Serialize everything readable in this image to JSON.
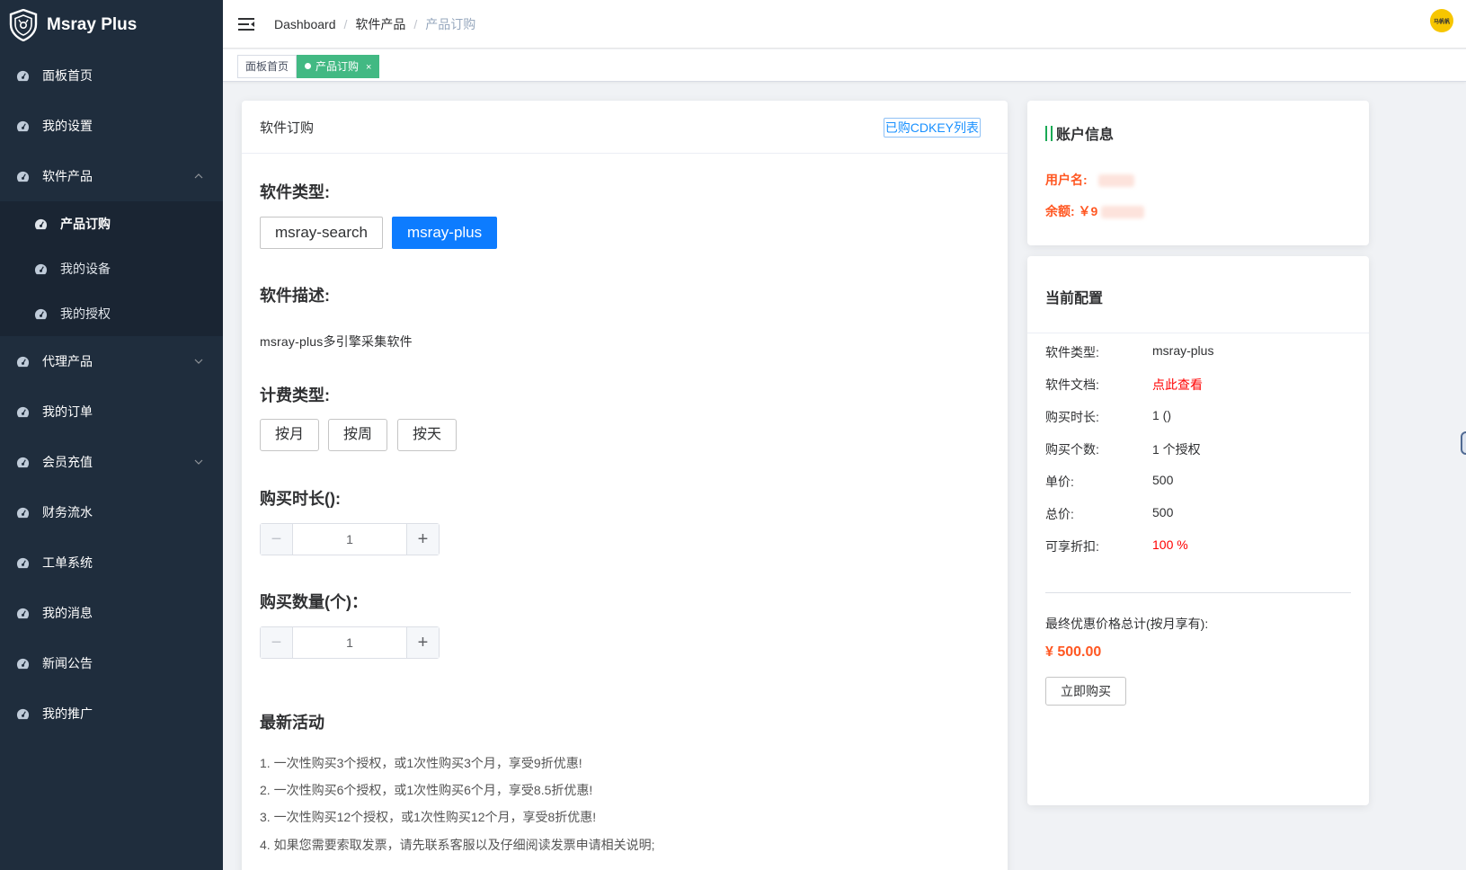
{
  "app": {
    "title": "Msray Plus"
  },
  "sidebar": {
    "items": [
      {
        "label": "面板首页"
      },
      {
        "label": "我的设置"
      },
      {
        "label": "软件产品"
      },
      {
        "label": "代理产品"
      },
      {
        "label": "我的订单"
      },
      {
        "label": "会员充值"
      },
      {
        "label": "财务流水"
      },
      {
        "label": "工单系统"
      },
      {
        "label": "我的消息"
      },
      {
        "label": "新闻公告"
      },
      {
        "label": "我的推广"
      }
    ],
    "submenu": [
      {
        "label": "产品订购"
      },
      {
        "label": "我的设备"
      },
      {
        "label": "我的授权"
      }
    ]
  },
  "header": {
    "breadcrumb": [
      "Dashboard",
      "软件产品",
      "产品订购"
    ],
    "breadcrumb_sep": "/",
    "avatar_text": "马帆帆"
  },
  "tags": [
    {
      "label": "面板首页"
    },
    {
      "label": "产品订购",
      "close": "×"
    }
  ],
  "main": {
    "card_title": "软件订购",
    "cdkey_button": "已购CDKEY列表",
    "software_type_title": "软件类型:",
    "software_types": [
      "msray-search",
      "msray-plus"
    ],
    "selected_type": "msray-plus",
    "description_title": "软件描述:",
    "description": "msray-plus多引擎采集软件",
    "billing_title": "计费类型:",
    "billing_types": [
      "按月",
      "按周",
      "按天"
    ],
    "duration_title": "购买时长():",
    "duration_value": "1",
    "quantity_title": "购买数量(个)：",
    "quantity_value": "1",
    "activity_title": "最新活动",
    "activities": [
      "1. 一次性购买3个授权，或1次性购买3个月，享受9折优惠!",
      "2. 一次性购买6个授权，或1次性购买6个月，享受8.5折优惠!",
      "3. 一次性购买12个授权，或1次性购买12个月，享受8折优惠!",
      "4. 如果您需要索取发票，请先联系客服以及仔细阅读发票申请相关说明;"
    ]
  },
  "account": {
    "title": "账户信息",
    "username_label": "用户名:",
    "balance_label": "余额: ￥9"
  },
  "config": {
    "title": "当前配置",
    "rows": [
      {
        "k": "软件类型:",
        "v": "msray-plus"
      },
      {
        "k": "软件文档:",
        "v": "点此查看"
      },
      {
        "k": "购买时长:",
        "v": "1 ()"
      },
      {
        "k": "购买个数:",
        "v": "1 个授权"
      },
      {
        "k": "单价:",
        "v": "500"
      },
      {
        "k": "总价:",
        "v": "500"
      },
      {
        "k": "可享折扣:",
        "v": "100 %"
      }
    ],
    "final_label": "最终优惠价格总计(按月享有):",
    "final_price": "¥ 500.00",
    "buy_button": "立即购买"
  },
  "colors": {
    "sidebar_bg": "#1f2d3d",
    "primary": "#0d7cff",
    "tag_active": "#42b983",
    "accent_orange": "#ff5722",
    "red": "#ff0000"
  }
}
